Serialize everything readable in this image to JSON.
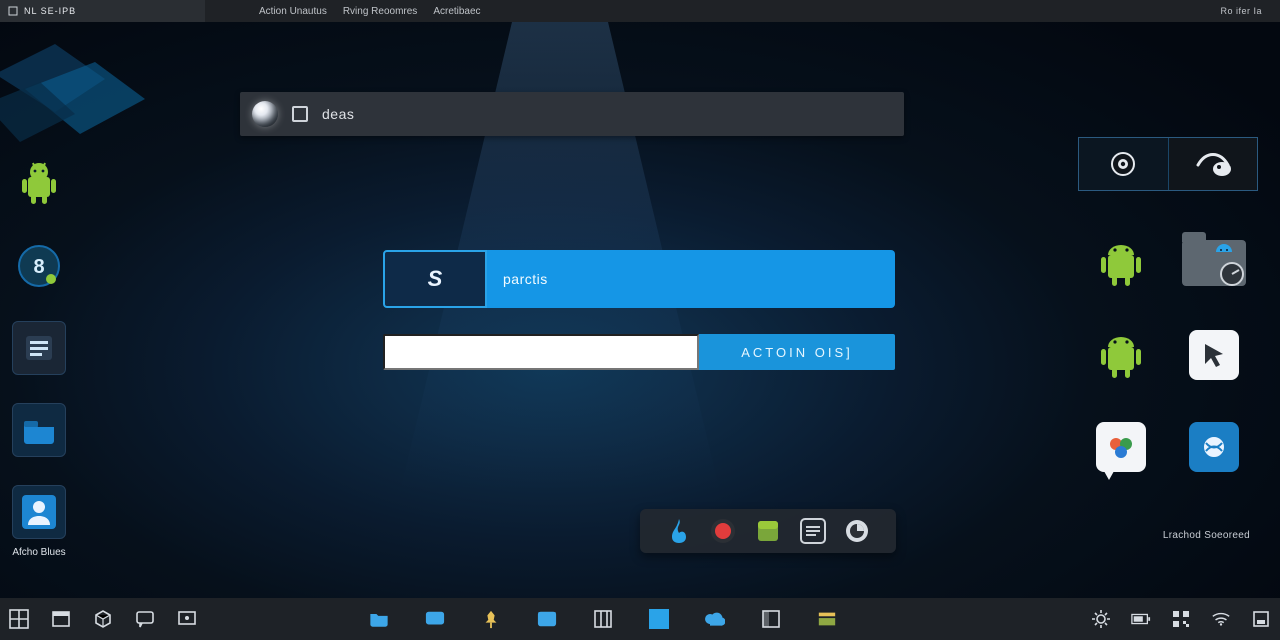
{
  "menubar": {
    "tag_text": "NL  SE-IPB",
    "items": [
      "Action Unautus",
      "Rving Reoomres",
      "Acretibaec"
    ],
    "right_text": "Ro ifer Ia"
  },
  "titlebar": {
    "text": "deas"
  },
  "card": {
    "lead_glyph": "S",
    "lead_text": "parctis",
    "field_value": "",
    "button_label": "ACTOIN OIS]"
  },
  "left_icons": {
    "android": "android-icon",
    "contacts": "contacts-icon",
    "list_app": "list-app-icon",
    "folder": "folder-icon",
    "user": "user-icon",
    "user_label": "Afcho Blues"
  },
  "tr_tool": {
    "eye": "eye-icon",
    "mouse": "mouse-icon"
  },
  "right_icons": {
    "android_a": "android-icon",
    "folder_disc": "folder-disc-icon",
    "android_b": "android-icon",
    "cursor_tile": "cursor-tile-icon",
    "chat_bubble": "chat-colors-icon",
    "globe_tile": "globe-tile-icon"
  },
  "right_label": "Lrachod Soeoreed",
  "minidock": {
    "items": [
      "flame-icon",
      "record-icon",
      "package-icon",
      "lines-icon",
      "ring-icon"
    ]
  },
  "taskbar": {
    "left": [
      "grid-icon",
      "window-icon",
      "box-icon",
      "chat-icon",
      "display-icon"
    ],
    "mid": [
      "folder-open-icon",
      "monitor-icon",
      "pin-icon",
      "panel-icon",
      "columns-icon",
      "square-icon",
      "cloud-icon",
      "sidebar-icon",
      "stack-icon"
    ],
    "right": [
      "gear-icon",
      "battery-icon",
      "qr-icon",
      "wifi-icon",
      "tray-icon"
    ]
  },
  "colors": {
    "accent": "#1596e6",
    "accent2": "#2aa3e8",
    "android": "#8fc93a"
  }
}
